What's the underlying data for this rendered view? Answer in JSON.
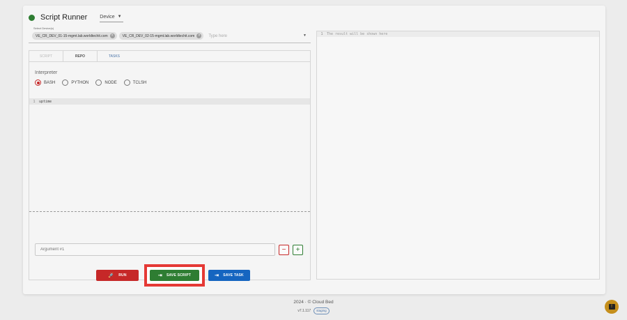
{
  "header": {
    "title": "Script Runner",
    "device_selector": "Device"
  },
  "device_field": {
    "label": "Select Device(s)",
    "chips": [
      "VE_CR_DEV_01-15-mgmt.lab.worldtechit.com",
      "VE_CR_DEV_02-15-mgmt.lab.worldtechit.com"
    ],
    "placeholder": "Type here"
  },
  "tabs": [
    "SCRIPT",
    "REPO",
    "TASKS"
  ],
  "interpreter": {
    "label": "Interpreter",
    "options": [
      "BASH",
      "PYTHON",
      "NODE",
      "TCLSH"
    ],
    "selected": "BASH"
  },
  "editor": {
    "lines": [
      {
        "num": "1",
        "text": "uptime"
      }
    ]
  },
  "argument": {
    "placeholder": "Argument #1",
    "minus": "−",
    "plus": "+"
  },
  "actions": {
    "run": "RUN",
    "save_script": "SAVE SCRIPT",
    "save_task": "SAVE TASK"
  },
  "result": {
    "line_num": "1",
    "placeholder": "The result will be shown here"
  },
  "footer": {
    "copyright": "2024 · © Cloud Bed",
    "version": "v7.1.117",
    "env_badge": "staging"
  },
  "colors": {
    "status_online": "#2e7d32",
    "run": "#c62828",
    "save_script": "#2e7d32",
    "save_task": "#1565c0",
    "highlight": "#e53935",
    "fab": "#c58f1c"
  }
}
